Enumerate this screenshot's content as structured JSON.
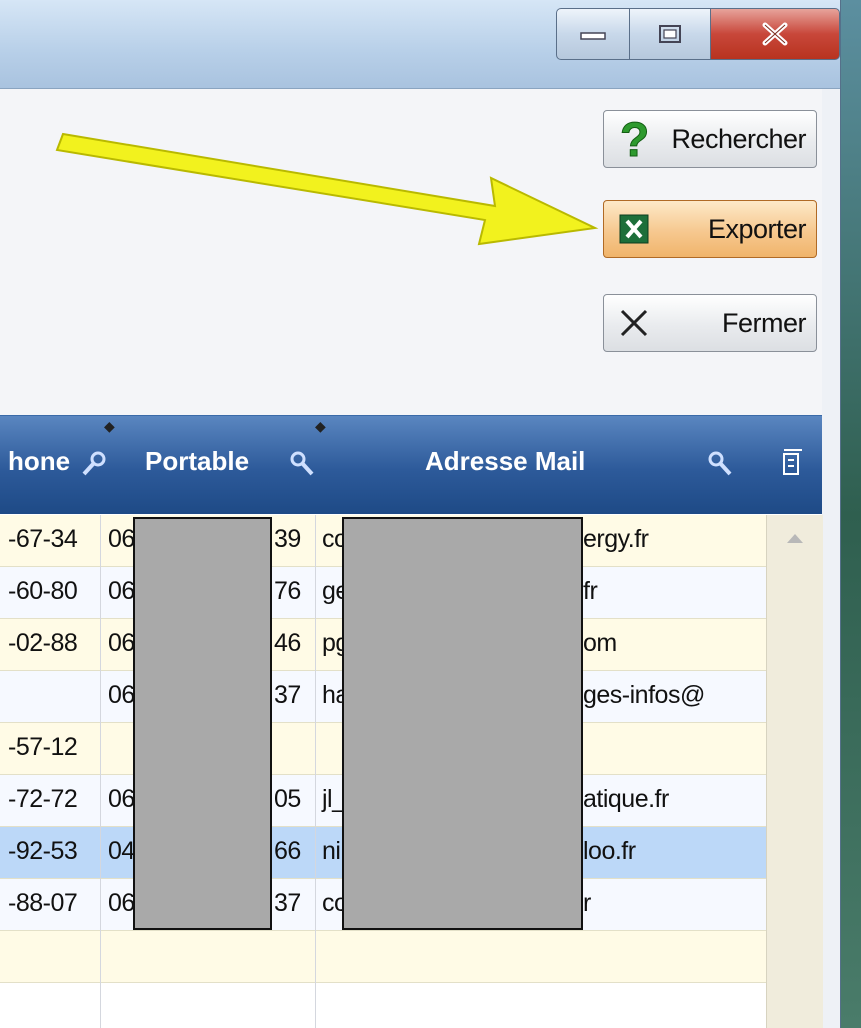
{
  "window": {
    "controls": {
      "minimize": "minimize",
      "maximize": "maximize",
      "close": "close"
    }
  },
  "actions": {
    "search_label": "Rechercher",
    "export_label": "Exporter",
    "close_label": "Fermer"
  },
  "grid": {
    "columns": [
      {
        "label": "hone",
        "icon": "search-icon"
      },
      {
        "label": "Portable",
        "icon": "search-icon"
      },
      {
        "label": "Adresse Mail",
        "icon": "search-icon"
      }
    ],
    "column_chooser_icon": "column-chooser-icon",
    "rows": [
      {
        "phone": "-67-34",
        "mobile_start": "06",
        "mobile_end": "39",
        "mail_start": "co",
        "mail_end": "ergy.fr",
        "style": "cream"
      },
      {
        "phone": "-60-80",
        "mobile_start": "06",
        "mobile_end": "76",
        "mail_start": "ge",
        "mail_end": "fr",
        "style": "white"
      },
      {
        "phone": "-02-88",
        "mobile_start": "06",
        "mobile_end": "46",
        "mail_start": "pg",
        "mail_end": "om",
        "style": "cream"
      },
      {
        "phone": "",
        "mobile_start": "06",
        "mobile_end": "37",
        "mail_start": "ha",
        "mail_end": "ges-infos@",
        "style": "white"
      },
      {
        "phone": "-57-12",
        "mobile_start": "",
        "mobile_end": "",
        "mail_start": "",
        "mail_end": "",
        "style": "cream"
      },
      {
        "phone": "-72-72",
        "mobile_start": "06",
        "mobile_end": "05",
        "mail_start": "jl_",
        "mail_end": "atique.fr",
        "style": "white"
      },
      {
        "phone": "-92-53",
        "mobile_start": "04",
        "mobile_end": "66",
        "mail_start": "ni",
        "mail_end": "loo.fr",
        "style": "sel"
      },
      {
        "phone": "-88-07",
        "mobile_start": "06",
        "mobile_end": "37",
        "mail_start": "co",
        "mail_end": "r",
        "style": "white"
      },
      {
        "phone": "",
        "mobile_start": "",
        "mobile_end": "",
        "mail_start": "",
        "mail_end": "",
        "style": "cream"
      }
    ]
  },
  "colors": {
    "header": "#2d5a9a",
    "selected_row": "#bcd8f8",
    "export_button": "#f6c88f",
    "arrow": "#f0f020"
  }
}
